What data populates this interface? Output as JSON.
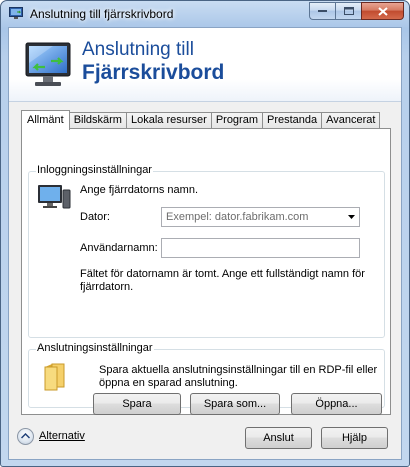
{
  "window": {
    "title": "Anslutning till fjärrskrivbord",
    "caption_buttons": [
      "minimize",
      "maximize",
      "close"
    ]
  },
  "banner": {
    "line1": "Anslutning till",
    "line2": "Fjärrskrivbord"
  },
  "tabs": [
    {
      "label": "Allmänt",
      "active": true
    },
    {
      "label": "Bildskärm",
      "active": false
    },
    {
      "label": "Lokala resurser",
      "active": false
    },
    {
      "label": "Program",
      "active": false
    },
    {
      "label": "Prestanda",
      "active": false
    },
    {
      "label": "Avancerat",
      "active": false
    }
  ],
  "logon": {
    "group_title": "Inloggningsinställningar",
    "instruction": "Ange fjärrdatorns namn.",
    "computer_label": "Dator:",
    "computer_placeholder": "Exempel: dator.fabrikam.com",
    "username_label": "Användarnamn:",
    "username_value": "",
    "warning_line1": "Fältet för datornamn är tomt. Ange ett fullständigt namn för",
    "warning_line2": "fjärrdatorn."
  },
  "connection": {
    "group_title": "Anslutningsinställningar",
    "description_line1": "Spara aktuella anslutningsinställningar till en RDP-fil eller",
    "description_line2": "öppna en sparad anslutning.",
    "save_label": "Spara",
    "save_as_label": "Spara som...",
    "open_label": "Öppna..."
  },
  "footer": {
    "options_label": "Alternativ",
    "connect_label": "Anslut",
    "help_label": "Hjälp"
  },
  "icons": {
    "title": "remote-desktop-icon",
    "banner": "remote-desktop-monitor-icon",
    "logon": "computer-icon",
    "connection": "folder-icon",
    "options": "chevron-up-icon"
  }
}
